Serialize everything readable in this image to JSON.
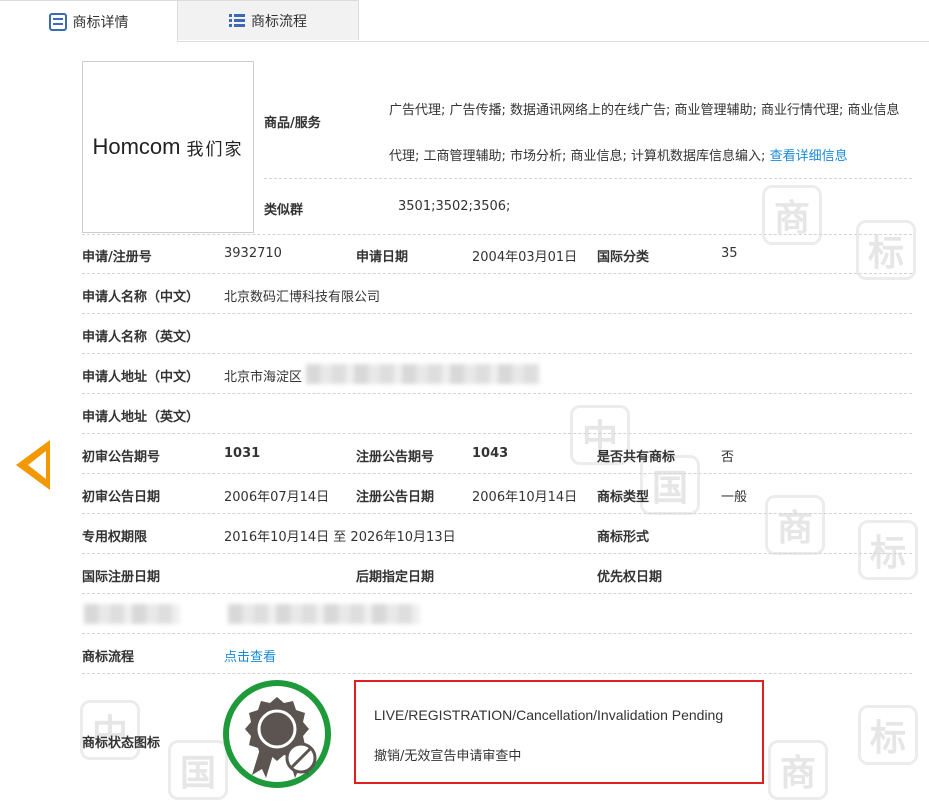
{
  "tabs": {
    "detail": "商标详情",
    "flow": "商标流程"
  },
  "logo": {
    "en": "Homcom",
    "cn": "我们家"
  },
  "goods_services": {
    "label": "商品/服务",
    "text": "广告代理; 广告传播; 数据通讯网络上的在线广告; 商业管理辅助; 商业行情代理; 商业信息代理; 工商管理辅助; 市场分析; 商业信息; 计算机数据库信息编入;",
    "more_link": "查看详细信息"
  },
  "similar_group": {
    "label": "类似群",
    "value": "3501;3502;3506;"
  },
  "reg_no": {
    "label": "申请/注册号",
    "value": "3932710"
  },
  "app_date": {
    "label": "申请日期",
    "value": "2004年03月01日"
  },
  "intl_class": {
    "label": "国际分类",
    "value": "35"
  },
  "applicant_cn": {
    "label": "申请人名称（中文）",
    "value": "北京数码汇博科技有限公司"
  },
  "applicant_en": {
    "label": "申请人名称（英文）",
    "value": ""
  },
  "address_cn": {
    "label": "申请人地址（中文）",
    "value": "北京市海淀区"
  },
  "address_en": {
    "label": "申请人地址（英文）",
    "value": ""
  },
  "prelim_issue": {
    "label": "初审公告期号",
    "value": "1031"
  },
  "reg_issue": {
    "label": "注册公告期号",
    "value": "1043"
  },
  "shared": {
    "label": "是否共有商标",
    "value": "否"
  },
  "prelim_date": {
    "label": "初审公告日期",
    "value": "2006年07月14日"
  },
  "reg_date": {
    "label": "注册公告日期",
    "value": "2006年10月14日"
  },
  "tm_type": {
    "label": "商标类型",
    "value": "一般"
  },
  "exclusive_period": {
    "label": "专用权期限",
    "value": "2016年10月14日 至 2026年10月13日"
  },
  "tm_form": {
    "label": "商标形式",
    "value": ""
  },
  "intl_reg_date": {
    "label": "国际注册日期",
    "value": ""
  },
  "later_designation": {
    "label": "后期指定日期",
    "value": ""
  },
  "priority_date": {
    "label": "优先权日期",
    "value": ""
  },
  "tm_flow": {
    "label": "商标流程",
    "link": "点击查看"
  },
  "status": {
    "label": "商标状态图标",
    "en": "LIVE/REGISTRATION/Cancellation/Invalidation Pending",
    "cn": "撤销/无效宣告申请审查中"
  },
  "watermark_chars": [
    "中",
    "国",
    "商",
    "标"
  ],
  "colors": {
    "accent": "#1a8bd6",
    "tab_icon": "#3d6ab5",
    "arrow": "#f39800",
    "status_ring": "#1f9a3a",
    "status_border": "#e02020",
    "badge": "#5b5450"
  }
}
